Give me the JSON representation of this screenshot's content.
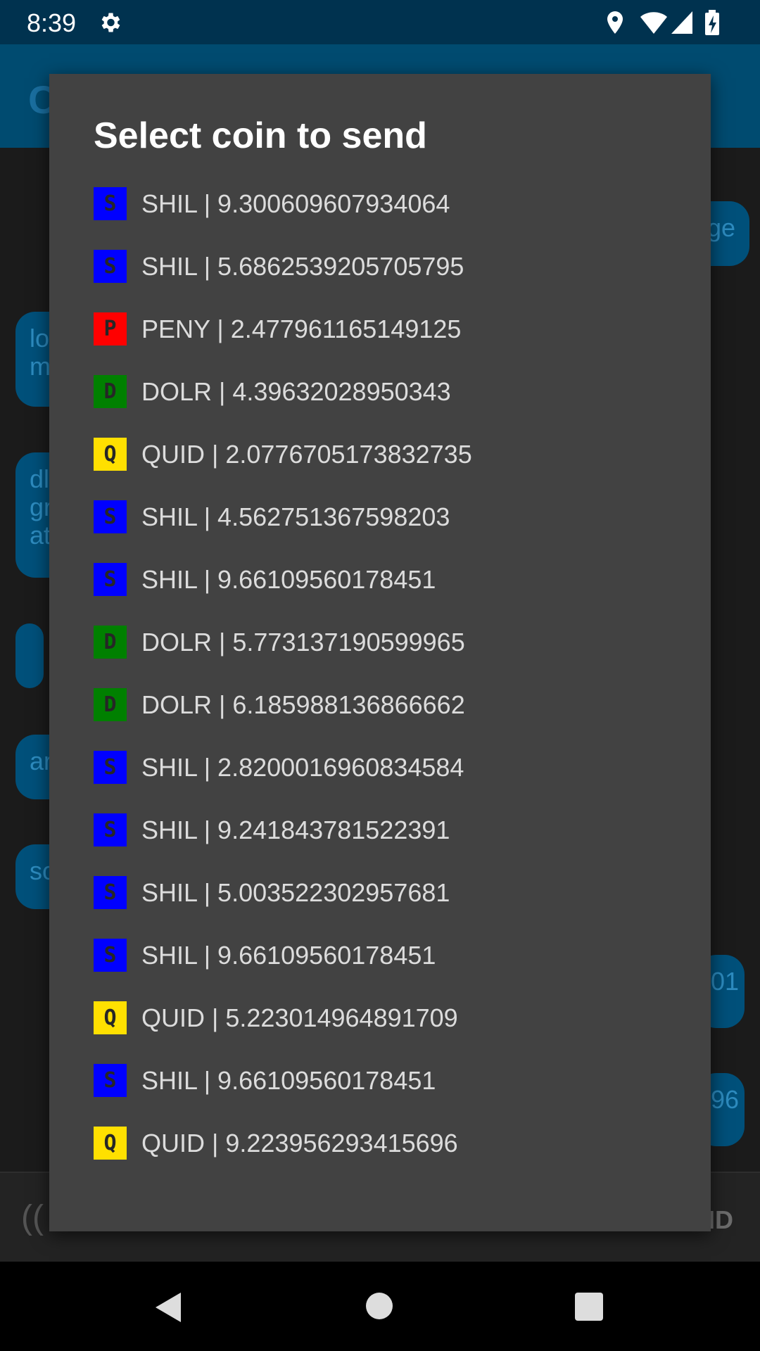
{
  "status_bar": {
    "time": "8:39"
  },
  "background_app": {
    "title_fragment": "C",
    "bubbles": [
      "ge",
      "lo\nm",
      "dl\ngr\nat",
      "",
      "ar",
      "sc",
      "01",
      "96"
    ],
    "input_fragment": "((",
    "send_fragment": "ND"
  },
  "dialog": {
    "title": "Select coin to send",
    "coins": [
      {
        "icon": "S",
        "label": "SHIL | 9.300609607934064",
        "color": "#0000ff"
      },
      {
        "icon": "S",
        "label": "SHIL | 5.6862539205705795",
        "color": "#0000ff"
      },
      {
        "icon": "P",
        "label": "PENY | 2.477961165149125",
        "color": "#ff0000"
      },
      {
        "icon": "D",
        "label": "DOLR | 4.39632028950343",
        "color": "#008000"
      },
      {
        "icon": "Q",
        "label": "QUID | 2.0776705173832735",
        "color": "#ffe000"
      },
      {
        "icon": "S",
        "label": "SHIL | 4.562751367598203",
        "color": "#0000ff"
      },
      {
        "icon": "S",
        "label": "SHIL | 9.66109560178451",
        "color": "#0000ff"
      },
      {
        "icon": "D",
        "label": "DOLR | 5.773137190599965",
        "color": "#008000"
      },
      {
        "icon": "D",
        "label": "DOLR | 6.185988136866662",
        "color": "#008000"
      },
      {
        "icon": "S",
        "label": "SHIL | 2.8200016960834584",
        "color": "#0000ff"
      },
      {
        "icon": "S",
        "label": "SHIL | 9.241843781522391",
        "color": "#0000ff"
      },
      {
        "icon": "S",
        "label": "SHIL | 5.003522302957681",
        "color": "#0000ff"
      },
      {
        "icon": "S",
        "label": "SHIL | 9.66109560178451",
        "color": "#0000ff"
      },
      {
        "icon": "Q",
        "label": "QUID | 5.223014964891709",
        "color": "#ffe000"
      },
      {
        "icon": "S",
        "label": "SHIL | 9.66109560178451",
        "color": "#0000ff"
      },
      {
        "icon": "Q",
        "label": "QUID | 9.223956293415696",
        "color": "#ffe000"
      }
    ]
  },
  "nav_bar": {
    "back_icon": "back-triangle-icon",
    "home_icon": "home-circle-icon",
    "recents_icon": "recents-square-icon"
  }
}
